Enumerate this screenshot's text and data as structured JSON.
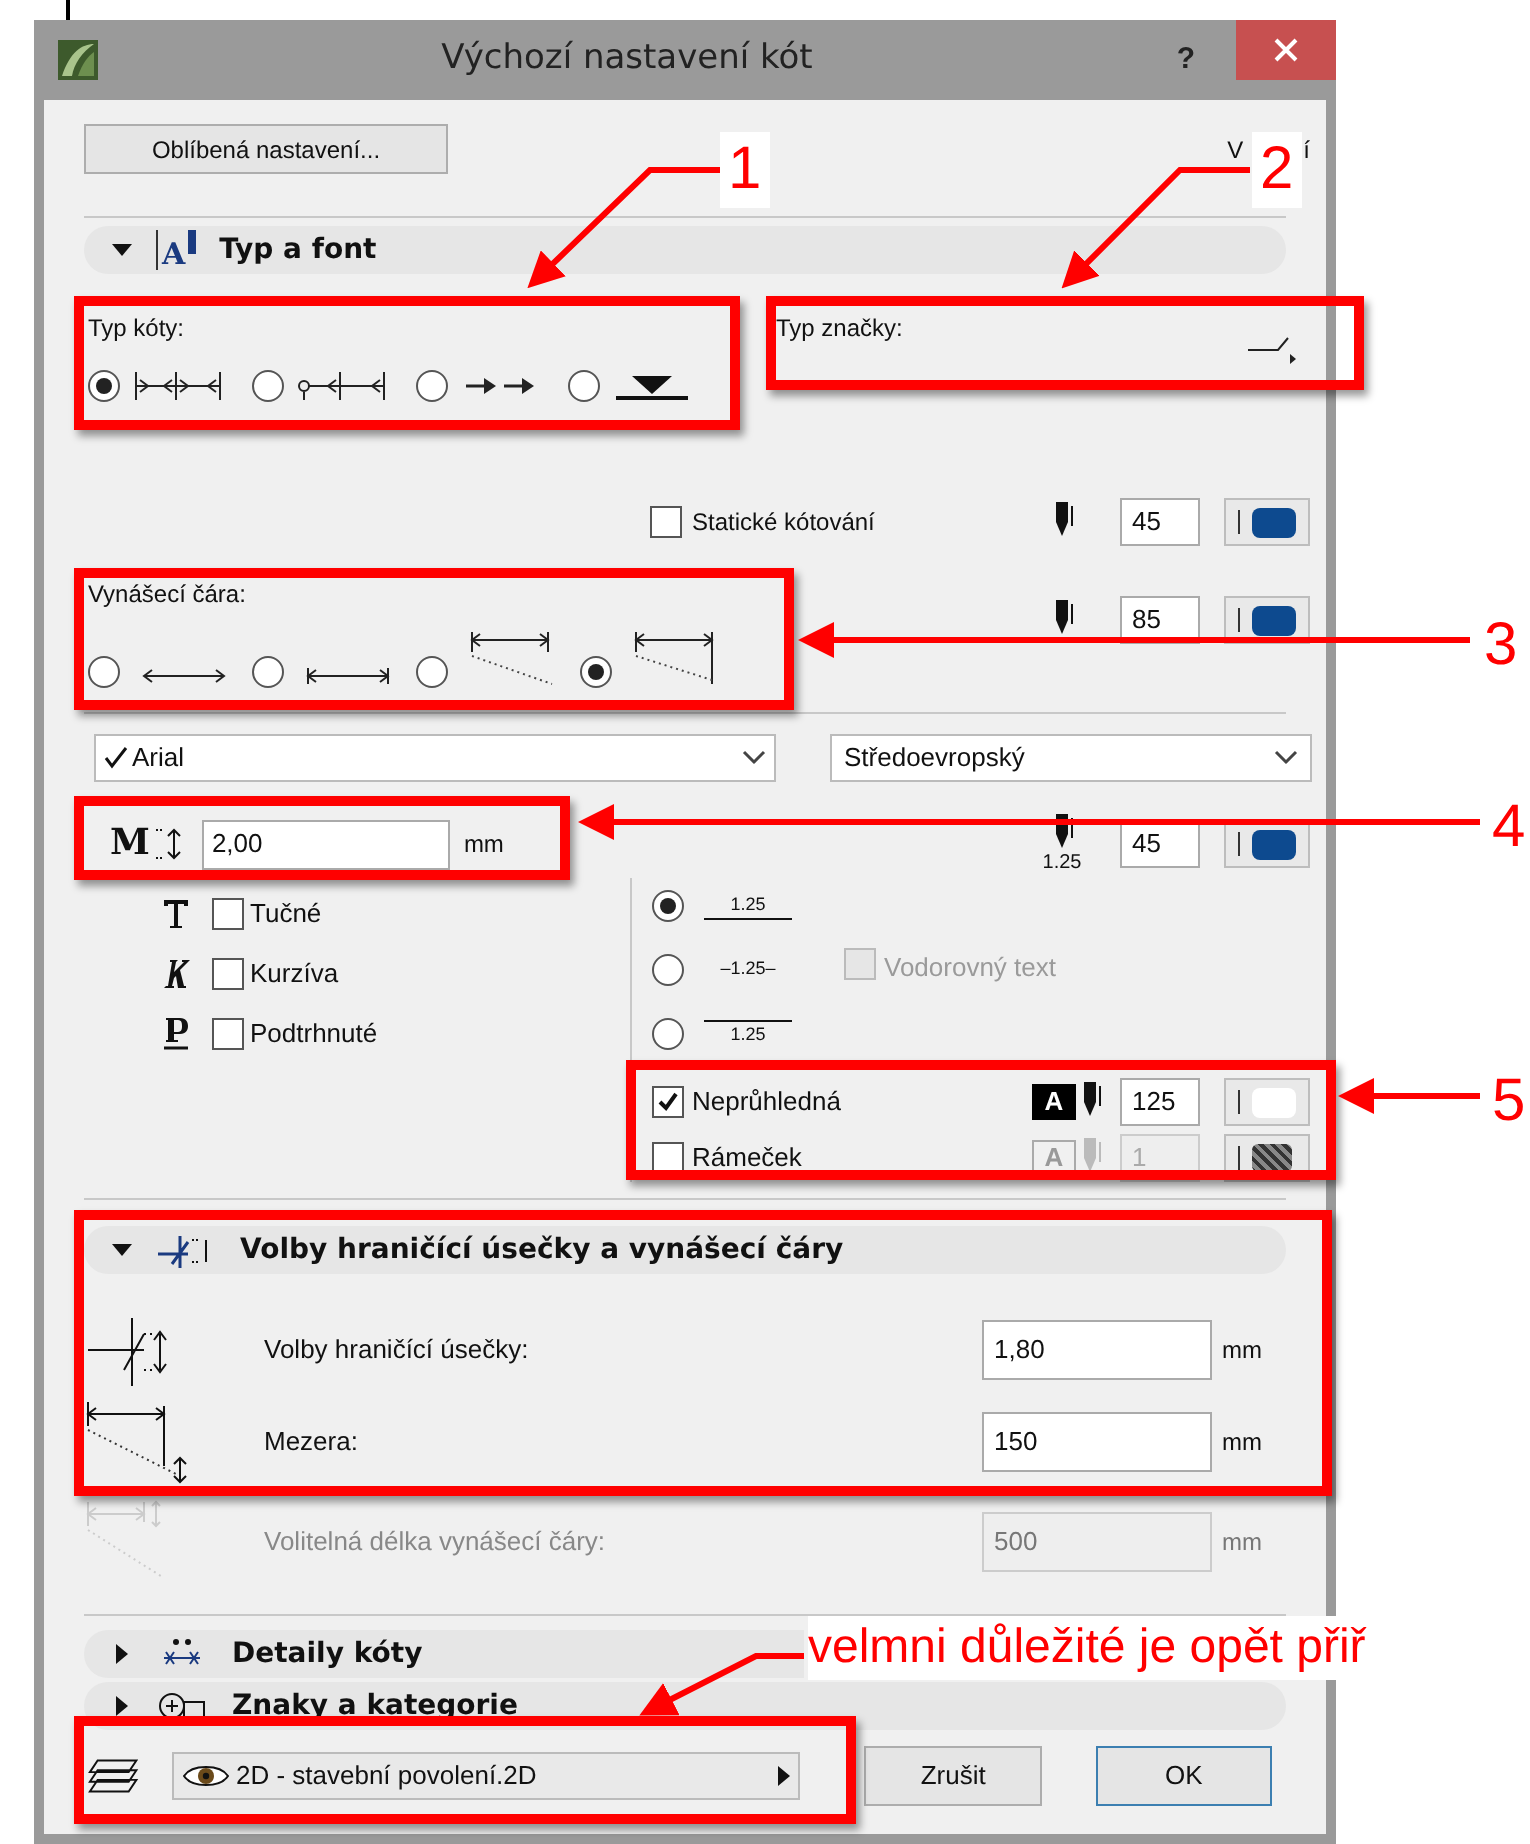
{
  "window": {
    "title": "Výchozí nastavení kót",
    "help_label": "?"
  },
  "favorites_button": "Oblíbená nastavení...",
  "top_right_fragments": [
    "V",
    "í"
  ],
  "sections": [
    {
      "title": "Typ a font",
      "expanded": true,
      "icon_letter": "A"
    },
    {
      "title": "Volby hraničící úsečky a vynášecí čáry",
      "expanded": true
    },
    {
      "title": "Detaily kóty",
      "expanded": false
    },
    {
      "title": "Znaky a kategorie",
      "expanded": false
    }
  ],
  "dimension_type": {
    "label": "Typ kóty:",
    "options": [
      {
        "kind": "ticks",
        "selected": true
      },
      {
        "kind": "dot-ticks",
        "selected": false
      },
      {
        "kind": "arrows",
        "selected": false
      },
      {
        "kind": "level",
        "selected": false
      }
    ]
  },
  "marker_type": {
    "label": "Typ značky:"
  },
  "static_dimension": {
    "label": "Statické kótování",
    "checked": false,
    "pen": "45",
    "color": "#0d4a8f"
  },
  "witness_line": {
    "label": "Vynášecí čára:",
    "options": [
      {
        "kind": "plain",
        "selected": false
      },
      {
        "kind": "ticked",
        "selected": false
      },
      {
        "kind": "sloped",
        "selected": false
      },
      {
        "kind": "sloped-long",
        "selected": true
      }
    ],
    "pen": "85",
    "color": "#0d4a8f"
  },
  "font": {
    "name": "Arial",
    "checked": true,
    "encoding": "Středoevropský",
    "size": "2,00",
    "size_icon_letter": "M",
    "unit": "mm",
    "pen_label": "1.25",
    "pen": "45",
    "color": "#0d4a8f"
  },
  "styles": [
    {
      "kind": "bold",
      "label": "Tučné",
      "checked": false
    },
    {
      "kind": "italic",
      "label": "Kurzíva",
      "checked": false
    },
    {
      "kind": "underline",
      "label": "Podtrhnuté",
      "checked": false
    }
  ],
  "text_position": [
    {
      "kind": "above",
      "label": "1.25",
      "selected": true
    },
    {
      "kind": "inline",
      "label": "–1.25–",
      "selected": false
    },
    {
      "kind": "below",
      "label": "1.25",
      "selected": false
    }
  ],
  "horizontal_text": {
    "label": "Vodorovný text",
    "checked": false,
    "disabled": true
  },
  "opaque": {
    "label": "Neprůhledná",
    "icon_letter": "A",
    "checked": true,
    "pen": "125",
    "color": "#ffffff"
  },
  "frame": {
    "label": "Rámeček",
    "icon_letter": "A",
    "checked": false,
    "pen": "1"
  },
  "witness_fields": [
    {
      "kind": "marker",
      "label": "Volby hraničící úsečky:",
      "value": "1,80",
      "unit": "mm",
      "disabled": false
    },
    {
      "kind": "gap",
      "label": "Mezera:",
      "value": "150",
      "unit": "mm",
      "disabled": false
    },
    {
      "kind": "length",
      "label": "Volitelná délka vynášecí čáry:",
      "value": "500",
      "unit": "mm",
      "disabled": true
    }
  ],
  "layer": {
    "value": "2D - stavební povolení.2D"
  },
  "buttons": [
    {
      "label": "Zrušit",
      "default": false
    },
    {
      "label": "OK",
      "default": true
    }
  ],
  "annotations": {
    "numbers": [
      "1",
      "2",
      "3",
      "4",
      "5"
    ],
    "note": "velmni důležité je opět přiř"
  }
}
